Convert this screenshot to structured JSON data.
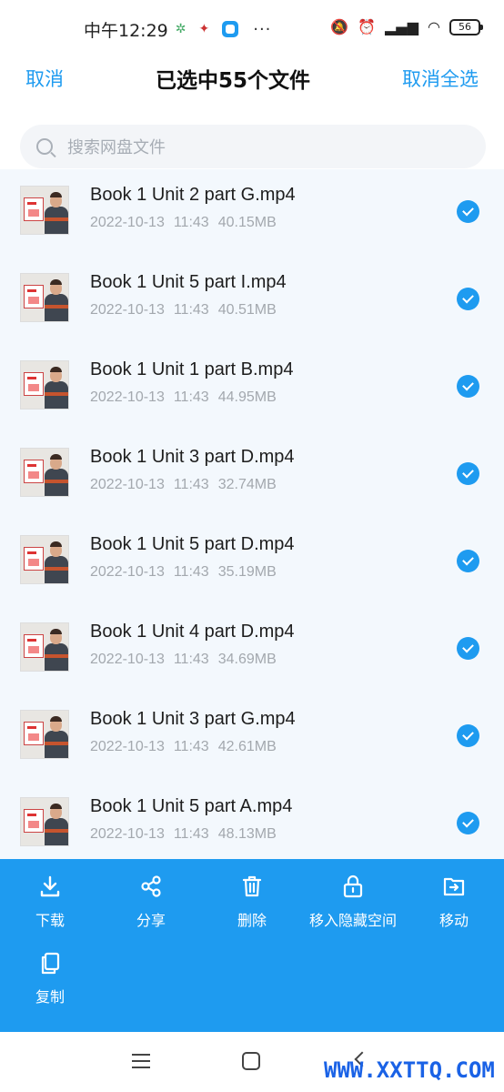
{
  "statusbar": {
    "time": "中午12:29",
    "battery": "56"
  },
  "header": {
    "cancel_label": "取消",
    "title": "已选中55个文件",
    "deselect_all_label": "取消全选"
  },
  "search": {
    "placeholder": "搜索网盘文件"
  },
  "files": [
    {
      "name": "Book 1 Unit 2 part G.mp4",
      "date": "2022-10-13",
      "time": "11:43",
      "size": "40.15MB",
      "checked": true
    },
    {
      "name": "Book 1 Unit 5 part I.mp4",
      "date": "2022-10-13",
      "time": "11:43",
      "size": "40.51MB",
      "checked": true
    },
    {
      "name": "Book 1 Unit 1 part B.mp4",
      "date": "2022-10-13",
      "time": "11:43",
      "size": "44.95MB",
      "checked": true
    },
    {
      "name": "Book 1 Unit 3 part D.mp4",
      "date": "2022-10-13",
      "time": "11:43",
      "size": "32.74MB",
      "checked": true
    },
    {
      "name": "Book 1 Unit 5 part D.mp4",
      "date": "2022-10-13",
      "time": "11:43",
      "size": "35.19MB",
      "checked": true
    },
    {
      "name": "Book 1 Unit 4 part D.mp4",
      "date": "2022-10-13",
      "time": "11:43",
      "size": "34.69MB",
      "checked": true
    },
    {
      "name": "Book 1 Unit 3 part G.mp4",
      "date": "2022-10-13",
      "time": "11:43",
      "size": "42.61MB",
      "checked": true
    },
    {
      "name": "Book 1 Unit 5 part A.mp4",
      "date": "2022-10-13",
      "time": "11:43",
      "size": "48.13MB",
      "checked": true
    }
  ],
  "actions": {
    "download": "下载",
    "share": "分享",
    "delete": "删除",
    "hide": "移入隐藏空间",
    "move": "移动",
    "copy": "复制"
  },
  "watermark": "WWW.XXTTQ.COM",
  "colors": {
    "accent": "#1e9bf0",
    "list_background": "#f3f8fd"
  }
}
